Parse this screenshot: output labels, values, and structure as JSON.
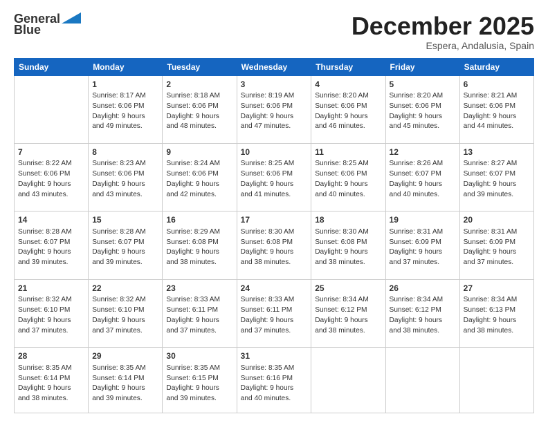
{
  "header": {
    "logo_line1": "General",
    "logo_line2": "Blue",
    "month": "December 2025",
    "location": "Espera, Andalusia, Spain"
  },
  "weekdays": [
    "Sunday",
    "Monday",
    "Tuesday",
    "Wednesday",
    "Thursday",
    "Friday",
    "Saturday"
  ],
  "weeks": [
    [
      {
        "day": "",
        "info": ""
      },
      {
        "day": "1",
        "info": "Sunrise: 8:17 AM\nSunset: 6:06 PM\nDaylight: 9 hours\nand 49 minutes."
      },
      {
        "day": "2",
        "info": "Sunrise: 8:18 AM\nSunset: 6:06 PM\nDaylight: 9 hours\nand 48 minutes."
      },
      {
        "day": "3",
        "info": "Sunrise: 8:19 AM\nSunset: 6:06 PM\nDaylight: 9 hours\nand 47 minutes."
      },
      {
        "day": "4",
        "info": "Sunrise: 8:20 AM\nSunset: 6:06 PM\nDaylight: 9 hours\nand 46 minutes."
      },
      {
        "day": "5",
        "info": "Sunrise: 8:20 AM\nSunset: 6:06 PM\nDaylight: 9 hours\nand 45 minutes."
      },
      {
        "day": "6",
        "info": "Sunrise: 8:21 AM\nSunset: 6:06 PM\nDaylight: 9 hours\nand 44 minutes."
      }
    ],
    [
      {
        "day": "7",
        "info": "Sunrise: 8:22 AM\nSunset: 6:06 PM\nDaylight: 9 hours\nand 43 minutes."
      },
      {
        "day": "8",
        "info": "Sunrise: 8:23 AM\nSunset: 6:06 PM\nDaylight: 9 hours\nand 43 minutes."
      },
      {
        "day": "9",
        "info": "Sunrise: 8:24 AM\nSunset: 6:06 PM\nDaylight: 9 hours\nand 42 minutes."
      },
      {
        "day": "10",
        "info": "Sunrise: 8:25 AM\nSunset: 6:06 PM\nDaylight: 9 hours\nand 41 minutes."
      },
      {
        "day": "11",
        "info": "Sunrise: 8:25 AM\nSunset: 6:06 PM\nDaylight: 9 hours\nand 40 minutes."
      },
      {
        "day": "12",
        "info": "Sunrise: 8:26 AM\nSunset: 6:07 PM\nDaylight: 9 hours\nand 40 minutes."
      },
      {
        "day": "13",
        "info": "Sunrise: 8:27 AM\nSunset: 6:07 PM\nDaylight: 9 hours\nand 39 minutes."
      }
    ],
    [
      {
        "day": "14",
        "info": "Sunrise: 8:28 AM\nSunset: 6:07 PM\nDaylight: 9 hours\nand 39 minutes."
      },
      {
        "day": "15",
        "info": "Sunrise: 8:28 AM\nSunset: 6:07 PM\nDaylight: 9 hours\nand 39 minutes."
      },
      {
        "day": "16",
        "info": "Sunrise: 8:29 AM\nSunset: 6:08 PM\nDaylight: 9 hours\nand 38 minutes."
      },
      {
        "day": "17",
        "info": "Sunrise: 8:30 AM\nSunset: 6:08 PM\nDaylight: 9 hours\nand 38 minutes."
      },
      {
        "day": "18",
        "info": "Sunrise: 8:30 AM\nSunset: 6:08 PM\nDaylight: 9 hours\nand 38 minutes."
      },
      {
        "day": "19",
        "info": "Sunrise: 8:31 AM\nSunset: 6:09 PM\nDaylight: 9 hours\nand 37 minutes."
      },
      {
        "day": "20",
        "info": "Sunrise: 8:31 AM\nSunset: 6:09 PM\nDaylight: 9 hours\nand 37 minutes."
      }
    ],
    [
      {
        "day": "21",
        "info": "Sunrise: 8:32 AM\nSunset: 6:10 PM\nDaylight: 9 hours\nand 37 minutes."
      },
      {
        "day": "22",
        "info": "Sunrise: 8:32 AM\nSunset: 6:10 PM\nDaylight: 9 hours\nand 37 minutes."
      },
      {
        "day": "23",
        "info": "Sunrise: 8:33 AM\nSunset: 6:11 PM\nDaylight: 9 hours\nand 37 minutes."
      },
      {
        "day": "24",
        "info": "Sunrise: 8:33 AM\nSunset: 6:11 PM\nDaylight: 9 hours\nand 37 minutes."
      },
      {
        "day": "25",
        "info": "Sunrise: 8:34 AM\nSunset: 6:12 PM\nDaylight: 9 hours\nand 38 minutes."
      },
      {
        "day": "26",
        "info": "Sunrise: 8:34 AM\nSunset: 6:12 PM\nDaylight: 9 hours\nand 38 minutes."
      },
      {
        "day": "27",
        "info": "Sunrise: 8:34 AM\nSunset: 6:13 PM\nDaylight: 9 hours\nand 38 minutes."
      }
    ],
    [
      {
        "day": "28",
        "info": "Sunrise: 8:35 AM\nSunset: 6:14 PM\nDaylight: 9 hours\nand 38 minutes."
      },
      {
        "day": "29",
        "info": "Sunrise: 8:35 AM\nSunset: 6:14 PM\nDaylight: 9 hours\nand 39 minutes."
      },
      {
        "day": "30",
        "info": "Sunrise: 8:35 AM\nSunset: 6:15 PM\nDaylight: 9 hours\nand 39 minutes."
      },
      {
        "day": "31",
        "info": "Sunrise: 8:35 AM\nSunset: 6:16 PM\nDaylight: 9 hours\nand 40 minutes."
      },
      {
        "day": "",
        "info": ""
      },
      {
        "day": "",
        "info": ""
      },
      {
        "day": "",
        "info": ""
      }
    ]
  ]
}
